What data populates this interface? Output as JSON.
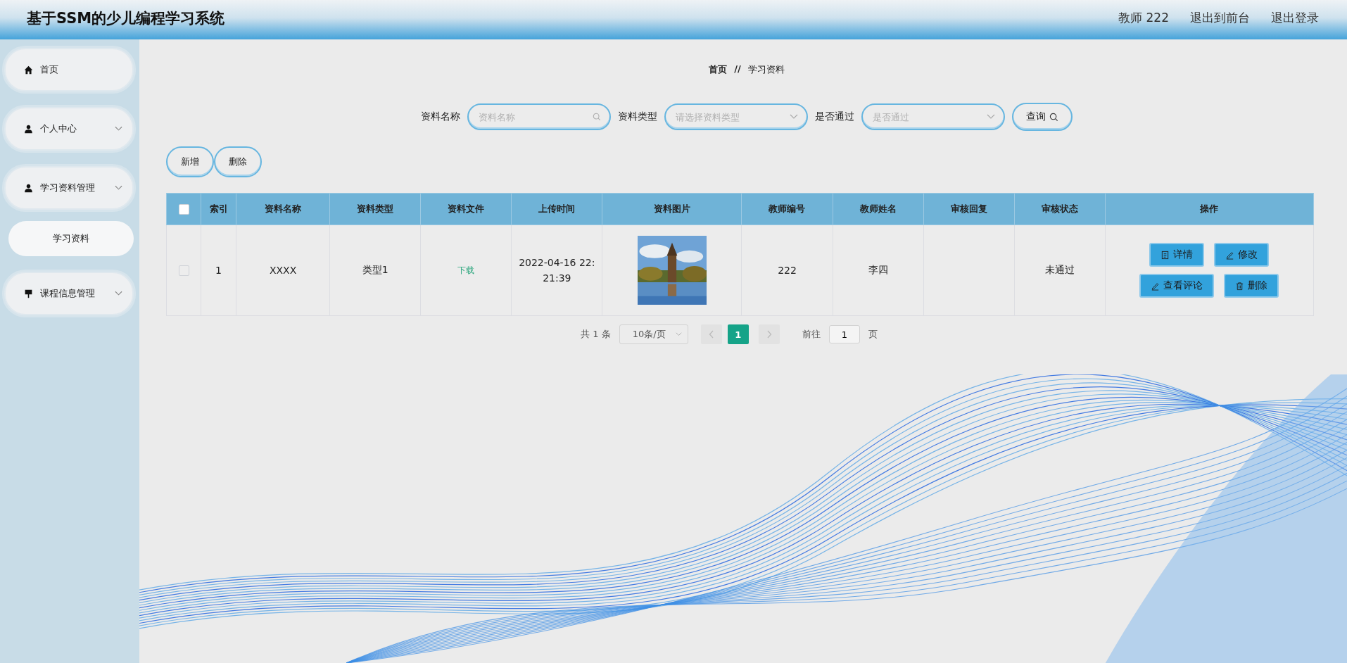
{
  "header": {
    "title": "基于SSM的少儿编程学习系统",
    "user": "教师 222",
    "links": [
      "退出到前台",
      "退出登录"
    ]
  },
  "sidebar": {
    "items": [
      {
        "label": "首页",
        "expandable": false,
        "selected": false
      },
      {
        "label": "个人中心",
        "expandable": true,
        "selected": false
      },
      {
        "label": "学习资料管理",
        "expandable": true,
        "selected": false,
        "children": [
          {
            "label": "学习资料",
            "selected": true
          }
        ]
      },
      {
        "label": "课程信息管理",
        "expandable": true,
        "selected": false
      }
    ]
  },
  "breadcrumb": [
    "首页",
    "学习资料"
  ],
  "breadcrumb_separator": "//",
  "search": {
    "fields": [
      {
        "label": "资料名称",
        "placeholder": "资料名称",
        "kind": "text"
      },
      {
        "label": "资料类型",
        "placeholder": "请选择资料类型",
        "kind": "select"
      },
      {
        "label": "是否通过",
        "placeholder": "是否通过",
        "kind": "select"
      }
    ],
    "button": "查询"
  },
  "actions": [
    "新增",
    "删除"
  ],
  "table": {
    "columns": [
      "索引",
      "资料名称",
      "资料类型",
      "资料文件",
      "上传时间",
      "资料图片",
      "教师编号",
      "教师姓名",
      "审核回复",
      "审核状态",
      "操作"
    ],
    "header_checked": false,
    "rows": [
      {
        "checked": false,
        "index": "1",
        "name": "XXXX",
        "type": "类型1",
        "file": "下载",
        "time": "2022-04-16 22:21:39",
        "teacher_no": "222",
        "teacher_name": "李四",
        "status": "未通过",
        "buttons": [
          {
            "label": "详情"
          },
          {
            "label": "修改"
          },
          {
            "label": "查看评论"
          },
          {
            "label": "删除"
          }
        ]
      }
    ]
  },
  "pagination": {
    "total": "共 1 条",
    "page_size": "10条/页",
    "pages": [
      {
        "label": "1",
        "selected": true
      }
    ],
    "goto_label": "前往",
    "goto_value": "1",
    "goto_suffix": "页"
  }
}
